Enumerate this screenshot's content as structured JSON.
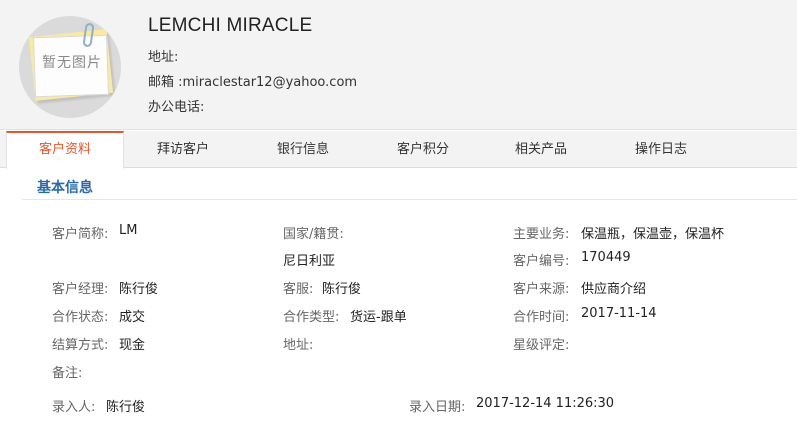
{
  "header": {
    "avatar_text": "暂无图片",
    "company_name": "LEMCHI MIRACLE",
    "address_label": "地址:",
    "address_value": "",
    "email_label": "邮箱 :",
    "email_value": "miraclestar12@yahoo.com",
    "phone_label": "办公电话:",
    "phone_value": ""
  },
  "tabs": [
    {
      "label": "客户资料",
      "active": true
    },
    {
      "label": "拜访客户",
      "active": false
    },
    {
      "label": "银行信息",
      "active": false
    },
    {
      "label": "客户积分",
      "active": false
    },
    {
      "label": "相关产品",
      "active": false
    },
    {
      "label": "操作日志",
      "active": false
    }
  ],
  "section": {
    "title": "基本信息"
  },
  "fields": {
    "short_name": {
      "label": "客户简称:",
      "value": "LM"
    },
    "country": {
      "label": "国家/籍贯:",
      "value": "尼日利亚"
    },
    "main_business": {
      "label": "主要业务:",
      "value": "保温瓶，保温壶，保温杯"
    },
    "customer_no": {
      "label": "客户编号:",
      "value": "170449"
    },
    "manager": {
      "label": "客户经理:",
      "value": "陈行俊"
    },
    "service": {
      "label": "客服:",
      "value": "陈行俊"
    },
    "source": {
      "label": "客户来源:",
      "value": "供应商介绍"
    },
    "coop_status": {
      "label": "合作状态:",
      "value": "成交"
    },
    "coop_type": {
      "label": "合作类型:",
      "value": "货运-跟单"
    },
    "coop_time": {
      "label": "合作时间:",
      "value": "2017-11-14"
    },
    "settlement": {
      "label": "结算方式:",
      "value": "现金"
    },
    "address": {
      "label": "地址:",
      "value": ""
    },
    "rating": {
      "label": "星级评定:",
      "value": ""
    },
    "remark": {
      "label": "备注:",
      "value": ""
    },
    "entered_by": {
      "label": "录入人:",
      "value": "陈行俊"
    },
    "entry_date": {
      "label": "录入日期:",
      "value": "2017-12-14 11:26:30"
    }
  },
  "colors": {
    "accent": "#e4572e",
    "section_title": "#2b6aa8",
    "header_bg": "#f3f3f3"
  }
}
